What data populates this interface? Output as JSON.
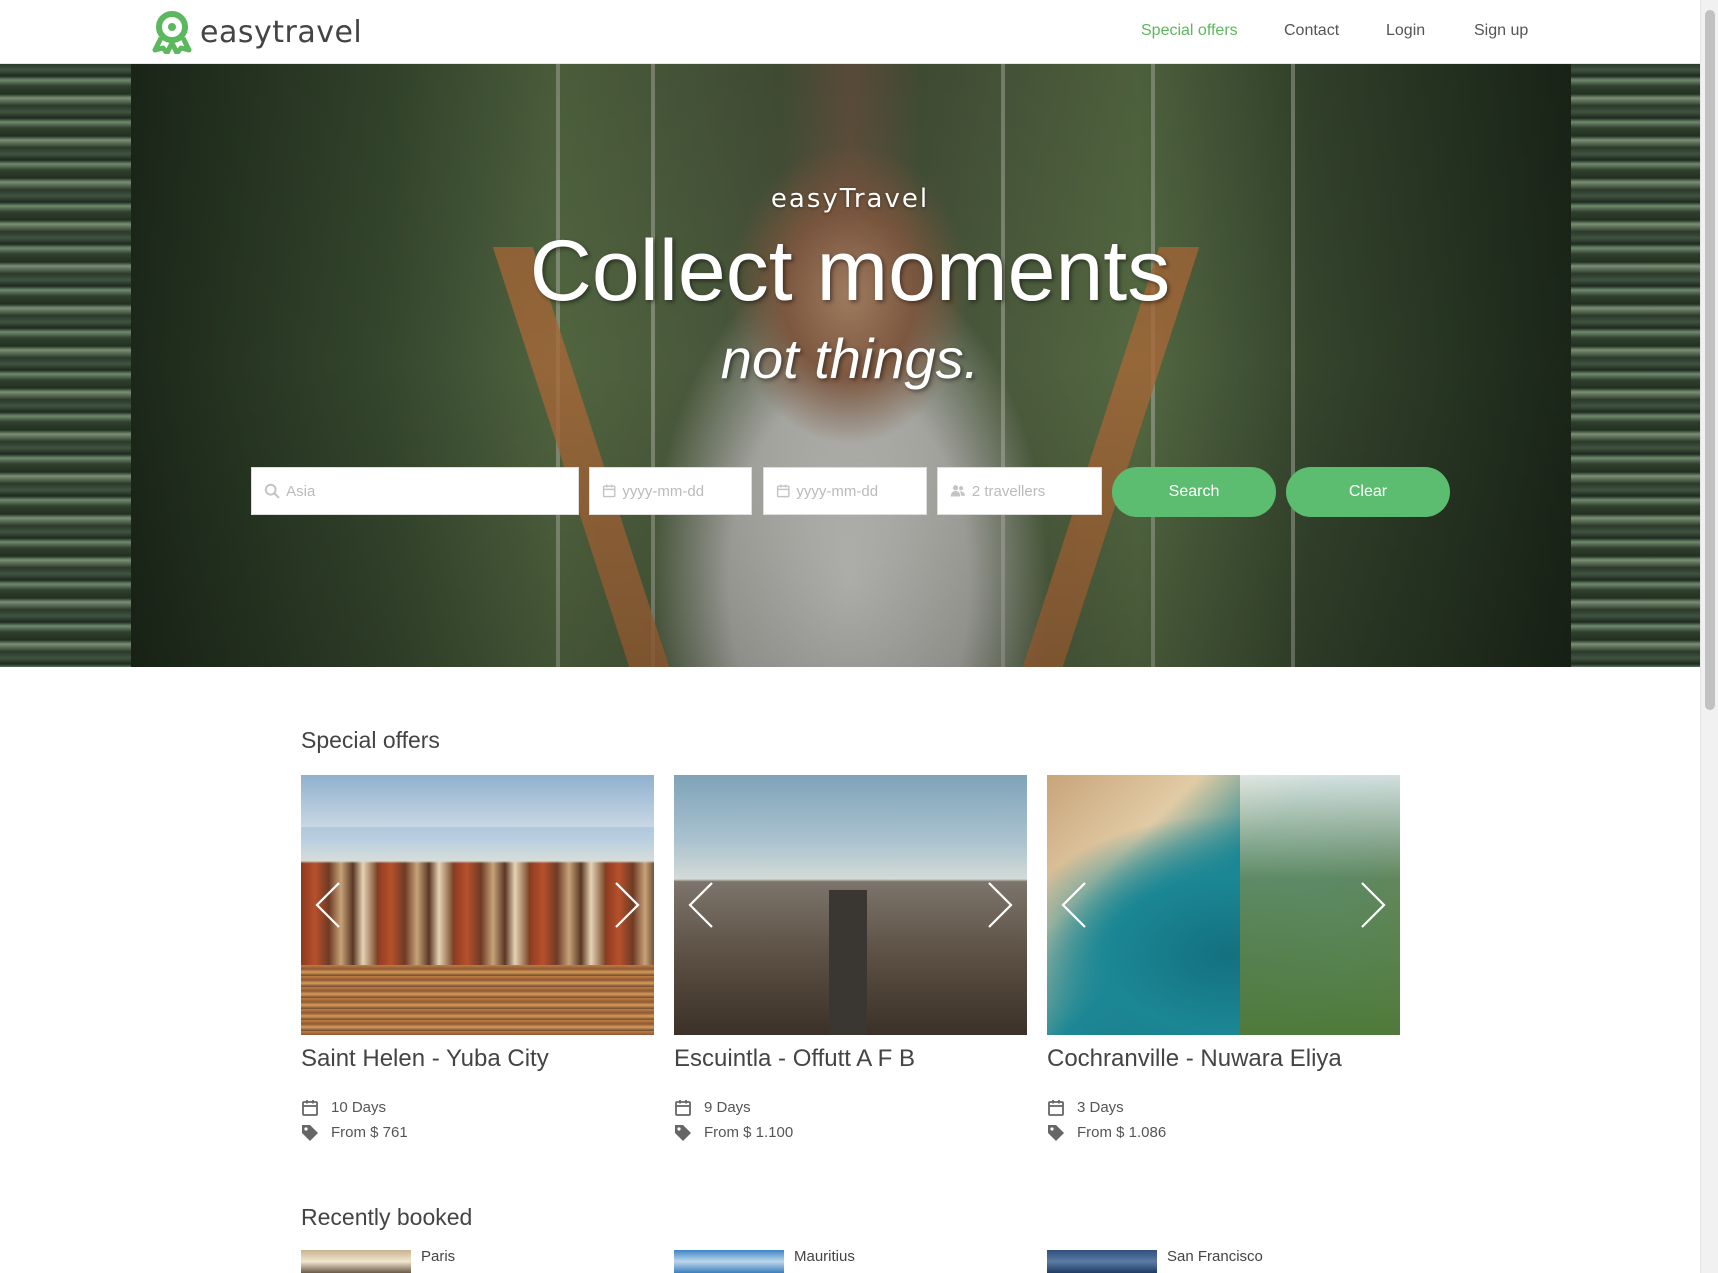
{
  "brand": {
    "name": "easytravel",
    "icon": "map-pin-icon",
    "color": "#5cb85c"
  },
  "nav": {
    "items": [
      {
        "label": "Special offers",
        "active": true
      },
      {
        "label": "Contact",
        "active": false
      },
      {
        "label": "Login",
        "active": false
      },
      {
        "label": "Sign up",
        "active": false
      }
    ]
  },
  "hero": {
    "brand_text": "easyTravel",
    "title": "Collect moments",
    "subtitle": "not things."
  },
  "search": {
    "destination_placeholder": "Asia",
    "from_date_placeholder": "yyyy-mm-dd",
    "to_date_placeholder": "yyyy-mm-dd",
    "travellers_placeholder": "2 travellers",
    "search_label": "Search",
    "clear_label": "Clear",
    "button_color": "#5cbd70"
  },
  "special_offers": {
    "title": "Special offers",
    "cards": [
      {
        "title": "Saint Helen - Yuba City",
        "duration": "10 Days",
        "price": "From $ 761",
        "image": "amsterdam-canal-houses"
      },
      {
        "title": "Escuintla - Offutt A F B",
        "duration": "9 Days",
        "price": "From $ 1.100",
        "image": "city-skyline-aerial"
      },
      {
        "title": "Cochranville - Nuwara Eliya",
        "duration": "3 Days",
        "price": "From $ 1.086",
        "image": "beach-bay-aerial"
      }
    ]
  },
  "recently_booked": {
    "title": "Recently booked",
    "items": [
      {
        "name": "Paris"
      },
      {
        "name": "Mauritius"
      },
      {
        "name": "San Francisco"
      }
    ]
  }
}
